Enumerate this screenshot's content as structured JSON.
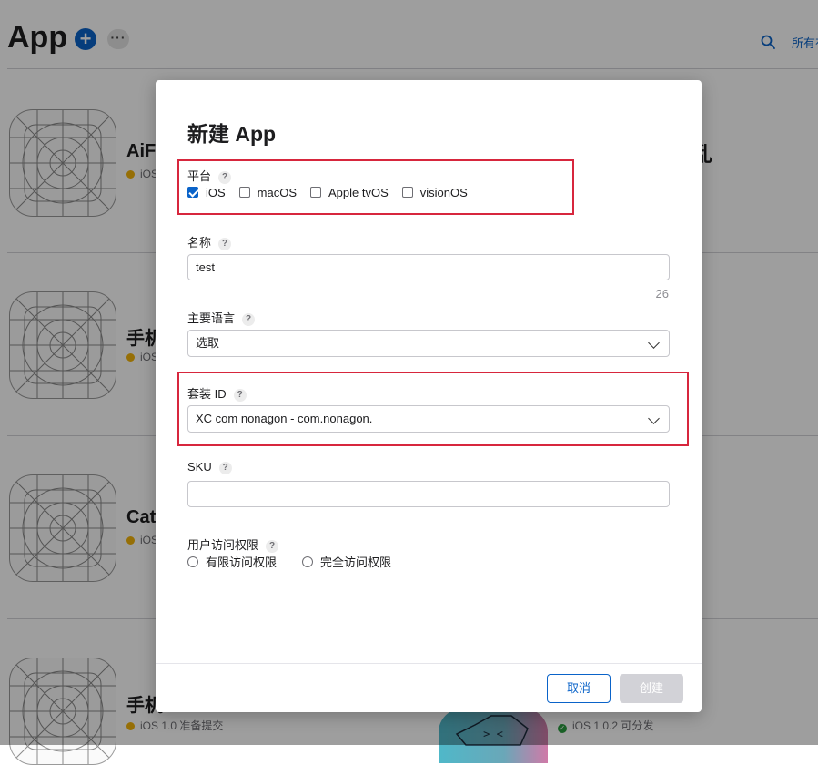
{
  "page": {
    "title": "App",
    "add_symbol": "+",
    "more_symbol": "···",
    "all_link": "所有有",
    "search_icon": "search-icon"
  },
  "apps": [
    {
      "name": "AiF",
      "status": "iOS"
    },
    {
      "name": "手机",
      "status": "iOS"
    },
    {
      "name": "Cat",
      "status": "iOS"
    },
    {
      "name": "手机",
      "status": "iOS 1.0 准备提交"
    }
  ],
  "bg_right": {
    "partial_char": "乱",
    "status": "iOS 1.0.2 可分发",
    "icon_glyph": "> <"
  },
  "modal": {
    "title": "新建 App",
    "platform": {
      "label": "平台",
      "help": "?",
      "options": [
        {
          "label": "iOS",
          "checked": true
        },
        {
          "label": "macOS",
          "checked": false
        },
        {
          "label": "Apple tvOS",
          "checked": false
        },
        {
          "label": "visionOS",
          "checked": false
        }
      ]
    },
    "name": {
      "label": "名称",
      "help": "?",
      "value": "test",
      "remaining": "26"
    },
    "language": {
      "label": "主要语言",
      "help": "?",
      "selected": "选取"
    },
    "bundle": {
      "label": "套装 ID",
      "help": "?",
      "selected": "XC com nonagon - com.nonagon."
    },
    "sku": {
      "label": "SKU",
      "help": "?",
      "value": ""
    },
    "access": {
      "label": "用户访问权限",
      "help": "?",
      "options": [
        {
          "label": "有限访问权限",
          "selected": false
        },
        {
          "label": "完全访问权限",
          "selected": false
        }
      ]
    },
    "buttons": {
      "cancel": "取消",
      "create": "创建"
    }
  },
  "colors": {
    "accent": "#0a63c9",
    "highlight": "#d7263d",
    "disabled": "#d2d2d7"
  }
}
